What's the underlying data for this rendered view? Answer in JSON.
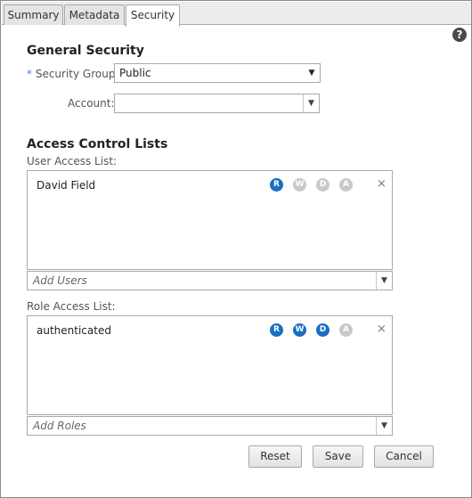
{
  "tabs": [
    {
      "label": "Summary",
      "active": false
    },
    {
      "label": "Metadata",
      "active": false
    },
    {
      "label": "Security",
      "active": true
    }
  ],
  "help_icon": "question-circle-icon",
  "general_security": {
    "title": "General Security",
    "required_marker": "*",
    "security_group_label": "Security Group:",
    "security_group_value": "Public",
    "account_label": "Account:",
    "account_value": ""
  },
  "acl": {
    "title": "Access Control Lists",
    "user_list": {
      "label": "User Access List:",
      "entries": [
        {
          "name": "David Field",
          "perms": {
            "R": true,
            "W": false,
            "D": false,
            "A": false
          }
        }
      ],
      "add_placeholder": "Add Users"
    },
    "role_list": {
      "label": "Role Access List:",
      "entries": [
        {
          "name": "authenticated",
          "perms": {
            "R": true,
            "W": true,
            "D": true,
            "A": false
          }
        }
      ],
      "add_placeholder": "Add Roles"
    },
    "perm_letters": [
      "R",
      "W",
      "D",
      "A"
    ],
    "remove_glyph": "×"
  },
  "buttons": {
    "reset": "Reset",
    "save": "Save",
    "cancel": "Cancel"
  },
  "colors": {
    "perm_on": "#1a6fc4",
    "perm_off": "#c9c9c9",
    "required_marker": "#4a86c8"
  }
}
